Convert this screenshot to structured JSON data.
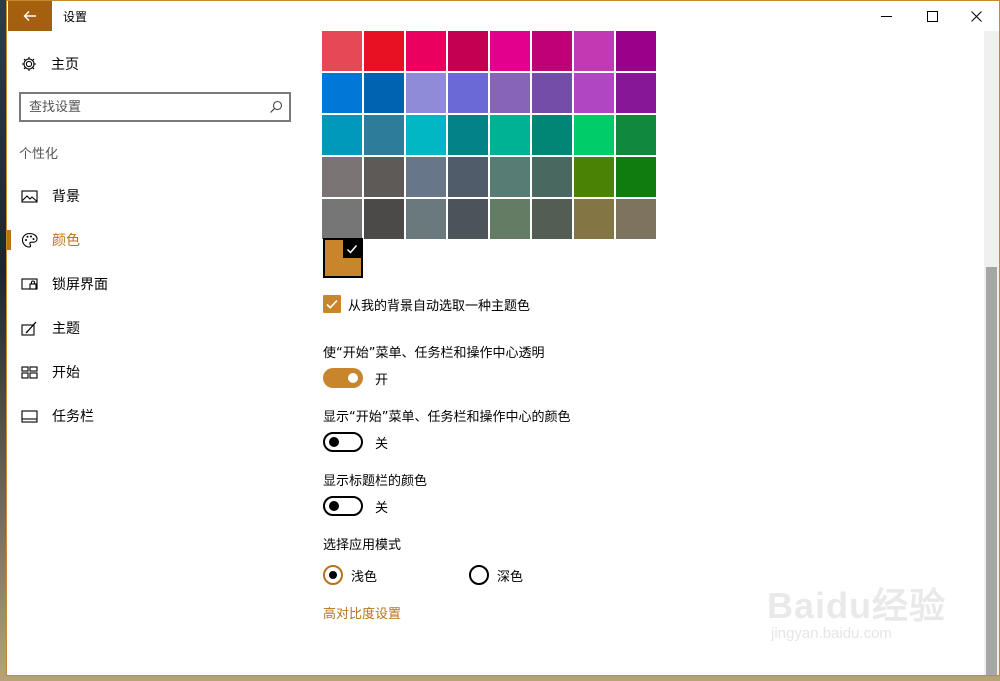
{
  "window": {
    "title": "设置",
    "accent": "#b8741b"
  },
  "sidebar": {
    "home_label": "主页",
    "search_placeholder": "查找设置",
    "section_heading": "个性化",
    "items": [
      {
        "label": "背景",
        "icon": "picture-icon",
        "active": false
      },
      {
        "label": "颜色",
        "icon": "palette-icon",
        "active": true
      },
      {
        "label": "锁屏界面",
        "icon": "lock-screen-icon",
        "active": false
      },
      {
        "label": "主题",
        "icon": "theme-brush-icon",
        "active": false
      },
      {
        "label": "开始",
        "icon": "start-tiles-icon",
        "active": false
      },
      {
        "label": "任务栏",
        "icon": "taskbar-icon",
        "active": false
      }
    ]
  },
  "colors": {
    "swatches": [
      "#e74856",
      "#e81123",
      "#ea005e",
      "#c30052",
      "#e3008c",
      "#bf0077",
      "#c239b3",
      "#9a0089",
      "#0078d7",
      "#0063b1",
      "#8e8cd8",
      "#6b69d6",
      "#8764b8",
      "#744da9",
      "#b146c2",
      "#881798",
      "#0099bc",
      "#2d7d9a",
      "#00b7c3",
      "#038387",
      "#00b294",
      "#018574",
      "#00cc6a",
      "#10893e",
      "#7a7574",
      "#5d5a58",
      "#68768a",
      "#515c6b",
      "#567c73",
      "#486860",
      "#498205",
      "#107c10",
      "#767676",
      "#4c4a48",
      "#69797e",
      "#4a5459",
      "#647c64",
      "#525e54",
      "#847545",
      "#7e735f"
    ],
    "custom_color": "#c9852b",
    "custom_selected": true
  },
  "options": {
    "auto_pick_label": "从我的背景自动选取一种主题色",
    "auto_pick_checked": true,
    "transparency_label": "使“开始”菜单、任务栏和操作中心透明",
    "transparency_state": "开",
    "show_color_start_label": "显示“开始”菜单、任务栏和操作中心的颜色",
    "show_color_start_state": "关",
    "show_titlebar_label": "显示标题栏的颜色",
    "show_titlebar_state": "关",
    "app_mode_label": "选择应用模式",
    "mode_light": "浅色",
    "mode_dark": "深色",
    "selected_mode": "浅色",
    "high_contrast_link": "高对比度设置"
  },
  "watermark": {
    "brand": "Baidu经验",
    "url": "jingyan.baidu.com"
  }
}
